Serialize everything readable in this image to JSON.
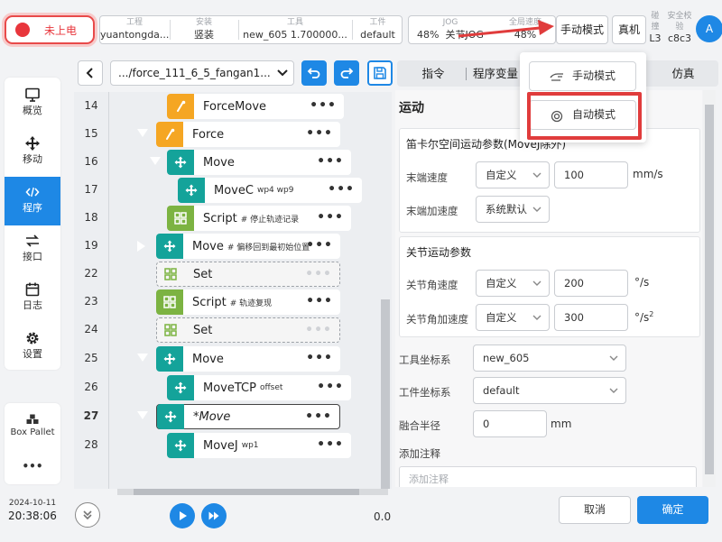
{
  "topbar": {
    "power": "未上电",
    "project": {
      "title": "工程",
      "value": "yuantongda..."
    },
    "install": {
      "title": "安装",
      "value": "竖装"
    },
    "tool": {
      "title": "工具",
      "value": "new_605   1.700000..."
    },
    "workpiece": {
      "title": "工件",
      "value": "default"
    },
    "jog": {
      "title": "JOG",
      "percent": "48%",
      "mode": "关节JOG"
    },
    "global_speed": {
      "title": "全局速度",
      "value": "48%"
    },
    "manual_mode_button": "手动模式",
    "real_machine_button": "真机",
    "collision": {
      "title": "碰撞",
      "value": "L3"
    },
    "safety_check": {
      "title": "安全校验",
      "value": "c8c3"
    },
    "avatar": "A"
  },
  "nav": {
    "items": [
      {
        "label": "概览",
        "icon": "monitor-icon"
      },
      {
        "label": "移动",
        "icon": "move-arrows-icon"
      },
      {
        "label": "程序",
        "icon": "code-icon"
      },
      {
        "label": "接口",
        "icon": "swap-icon"
      },
      {
        "label": "日志",
        "icon": "calendar-icon"
      },
      {
        "label": "设置",
        "icon": "gear-icon"
      }
    ],
    "active": "程序",
    "box_pallet": "Box Pallet",
    "more": "•••"
  },
  "datetime": {
    "date": "2024-10-11",
    "time": "20:38:06"
  },
  "program": {
    "path": ".../force_111_6_5_fangan1...",
    "rows": [
      {
        "num": "14",
        "name": "ForceMove",
        "note": "",
        "color": "#f5a623",
        "icon": "force-icon"
      },
      {
        "num": "15",
        "name": "Force",
        "note": "",
        "color": "#f5a623",
        "icon": "force-icon"
      },
      {
        "num": "16",
        "name": "Move",
        "note": "",
        "color": "#14a39a",
        "icon": "move-icon"
      },
      {
        "num": "17",
        "name": "MoveC",
        "note": "wp4 wp9",
        "color": "#14a39a",
        "icon": "move-icon"
      },
      {
        "num": "18",
        "name": "Script",
        "note": "# 停止轨迹记录",
        "color": "#7cb342",
        "icon": "script-icon"
      },
      {
        "num": "19",
        "name": "Move",
        "note": "# 偏移回到最初始位置",
        "color": "#14a39a",
        "icon": "move-icon"
      },
      {
        "num": "22",
        "name": "Set",
        "note": "",
        "color": "#7cb342",
        "icon": "script-icon"
      },
      {
        "num": "23",
        "name": "Script",
        "note": "# 轨迹复现",
        "color": "#7cb342",
        "icon": "script-icon"
      },
      {
        "num": "24",
        "name": "Set",
        "note": "",
        "color": "#7cb342",
        "icon": "script-icon"
      },
      {
        "num": "25",
        "name": "Move",
        "note": "",
        "color": "#14a39a",
        "icon": "move-icon"
      },
      {
        "num": "26",
        "name": "MoveTCP",
        "note": "offset",
        "color": "#14a39a",
        "icon": "move-icon"
      },
      {
        "num": "27",
        "name": "*Move",
        "note": "",
        "color": "#14a39a",
        "icon": "move-icon"
      },
      {
        "num": "28",
        "name": "MoveJ",
        "note": "wp1",
        "color": "#14a39a",
        "icon": "move-icon"
      }
    ],
    "more": "•••",
    "run_time": "0.0"
  },
  "panel": {
    "tabs": [
      "指令",
      "程序变量",
      "仿真"
    ],
    "title": "运动",
    "cartesian": {
      "title": "笛卡尔空间运动参数(MoveJ除外)",
      "end_speed_label": "末端速度",
      "end_speed_mode": "自定义",
      "end_speed_value": "100",
      "end_speed_unit": "mm/s",
      "end_accel_label": "末端加速度",
      "end_accel_mode": "系统默认"
    },
    "joint": {
      "title": "关节运动参数",
      "speed_label": "关节角速度",
      "speed_mode": "自定义",
      "speed_value": "200",
      "speed_unit": "°/s",
      "accel_label": "关节角加速度",
      "accel_mode": "自定义",
      "accel_value": "300",
      "accel_unit": "°/s",
      "accel_unit_sup": "2"
    },
    "tool_frame_label": "工具坐标系",
    "tool_frame_value": "new_605",
    "work_frame_label": "工件坐标系",
    "work_frame_value": "default",
    "blend_label": "融合半径",
    "blend_value": "0",
    "blend_unit": "mm",
    "note_label": "添加注释",
    "note_placeholder": "添加注释",
    "cancel": "取消",
    "confirm": "确定"
  },
  "mode_menu": {
    "manual": "手动模式",
    "auto": "自动模式"
  },
  "colors": {
    "accent": "#1e88e5",
    "danger": "#e03c3c",
    "orange": "#f5a623",
    "teal": "#14a39a",
    "green": "#7cb342"
  }
}
